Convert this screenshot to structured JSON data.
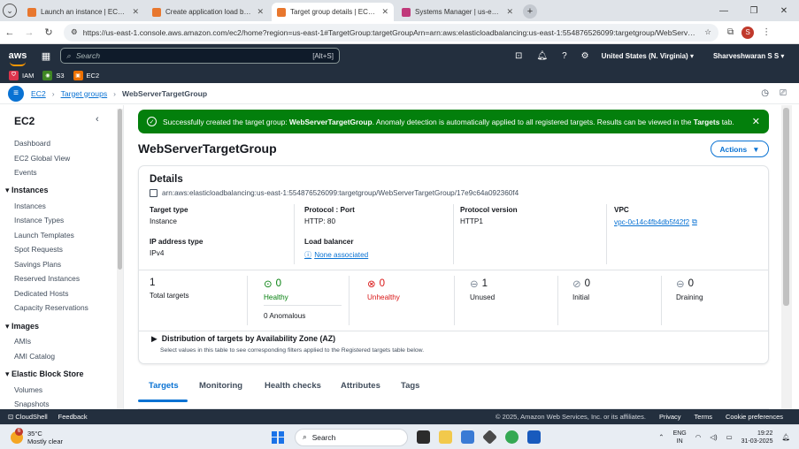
{
  "browser": {
    "tabs": [
      {
        "label": "Launch an instance | EC2 | us-east-1",
        "favicon": "orange",
        "active": false
      },
      {
        "label": "Create application load balancer",
        "favicon": "orange",
        "active": false
      },
      {
        "label": "Target group details | EC2 | us-east-1",
        "favicon": "orange",
        "active": true
      },
      {
        "label": "Systems Manager | us-east-1",
        "favicon": "pink",
        "active": false
      }
    ],
    "url": "https://us-east-1.console.aws.amazon.com/ec2/home?region=us-east-1#TargetGroup:targetGroupArn=arn:aws:elasticloadbalancing:us-east-1:554876526099:targetgroup/WebServerTargetGrou...",
    "profile_initial": "S"
  },
  "aws_header": {
    "logo": "aws",
    "search_placeholder": "Search",
    "search_shortcut": "[Alt+S]",
    "region": "United States (N. Virginia) ▾",
    "user": "Sharveshwaran S S ▾"
  },
  "favorites": [
    {
      "label": "IAM",
      "color": "#dd344c"
    },
    {
      "label": "S3",
      "color": "#3f8624"
    },
    {
      "label": "EC2",
      "color": "#ed7100"
    }
  ],
  "breadcrumb": {
    "items": [
      "EC2",
      "Target groups"
    ],
    "current": "WebServerTargetGroup",
    "separator": "›"
  },
  "sidebar": {
    "title": "EC2",
    "top_items": [
      "Dashboard",
      "EC2 Global View",
      "Events"
    ],
    "sections": [
      {
        "title": "Instances",
        "items": [
          "Instances",
          "Instance Types",
          "Launch Templates",
          "Spot Requests",
          "Savings Plans",
          "Reserved Instances",
          "Dedicated Hosts",
          "Capacity Reservations"
        ]
      },
      {
        "title": "Images",
        "items": [
          "AMIs",
          "AMI Catalog"
        ]
      },
      {
        "title": "Elastic Block Store",
        "items": [
          "Volumes",
          "Snapshots"
        ]
      }
    ]
  },
  "flash": {
    "prefix": "Successfully created the target group: ",
    "name": "WebServerTargetGroup",
    "middle": ". Anomaly detection is automatically applied to all registered targets. Results can be viewed in the ",
    "tab_ref": "Targets",
    "suffix": " tab."
  },
  "page": {
    "title": "WebServerTargetGroup",
    "actions_label": "Actions"
  },
  "details": {
    "heading": "Details",
    "arn": "arn:aws:elasticloadbalancing:us-east-1:554876526099:targetgroup/WebServerTargetGroup/17e9c64a092360f4",
    "target_type": {
      "label": "Target type",
      "value": "Instance"
    },
    "protocol_port": {
      "label": "Protocol : Port",
      "value": "HTTP: 80"
    },
    "protocol_version": {
      "label": "Protocol version",
      "value": "HTTP1"
    },
    "vpc": {
      "label": "VPC",
      "value": "vpc-0c14c4fb4db5f42f2"
    },
    "ip_type": {
      "label": "IP address type",
      "value": "IPv4"
    },
    "load_balancer": {
      "label": "Load balancer",
      "value": "None associated"
    }
  },
  "stats": {
    "total": {
      "value": "1",
      "label": "Total targets"
    },
    "healthy": {
      "value": "0",
      "label": "Healthy",
      "anomalous": "0 Anomalous"
    },
    "unhealthy": {
      "value": "0",
      "label": "Unhealthy"
    },
    "unused": {
      "value": "1",
      "label": "Unused"
    },
    "initial": {
      "value": "0",
      "label": "Initial"
    },
    "draining": {
      "value": "0",
      "label": "Draining"
    }
  },
  "distribution": {
    "title": "Distribution of targets by Availability Zone (AZ)",
    "subtitle": "Select values in this table to see corresponding filters applied to the Registered targets table below."
  },
  "tabs": [
    "Targets",
    "Monitoring",
    "Health checks",
    "Attributes",
    "Tags"
  ],
  "footer": {
    "cloudshell": "CloudShell",
    "feedback": "Feedback",
    "copyright": "© 2025, Amazon Web Services, Inc. or its affiliates.",
    "links": [
      "Privacy",
      "Terms",
      "Cookie preferences"
    ]
  },
  "taskbar": {
    "temp": "35°C",
    "weather": "Mostly clear",
    "weather_badge": "6",
    "search": "Search",
    "lang_top": "ENG",
    "lang_bottom": "IN",
    "time": "19:22",
    "date": "31-03-2025"
  }
}
